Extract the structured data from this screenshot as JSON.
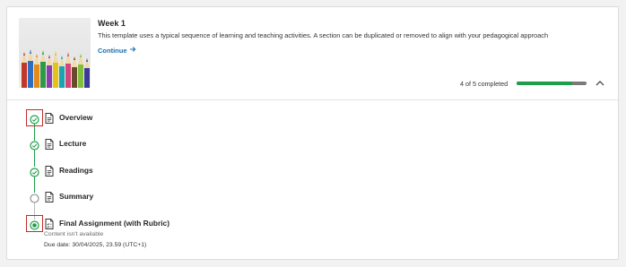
{
  "section": {
    "title": "Week 1",
    "description": "This template uses a typical sequence of learning and teaching activities. A section can be duplicated or removed to align with your pedagogical approach",
    "continue_label": "Continue",
    "progress_text": "4 of 5 completed",
    "progress_fraction": 0.8,
    "collapse_icon": "chevron-up-icon"
  },
  "items": [
    {
      "label": "Overview",
      "status": "completed",
      "icon": "document-icon"
    },
    {
      "label": "Lecture",
      "status": "completed",
      "icon": "document-icon"
    },
    {
      "label": "Readings",
      "status": "completed",
      "icon": "document-icon"
    },
    {
      "label": "Summary",
      "status": "not-started",
      "icon": "document-icon"
    },
    {
      "label": "Final Assignment (with Rubric)",
      "status": "current",
      "icon": "assignment-icon",
      "availability": "Content isn't available",
      "due_date": "Due date: 30/04/2025, 23.59 (UTC+1)"
    }
  ],
  "colors": {
    "accent_green": "#1e9e4a",
    "link_blue": "#1a6fb0",
    "highlight_red": "#c22b2b"
  }
}
